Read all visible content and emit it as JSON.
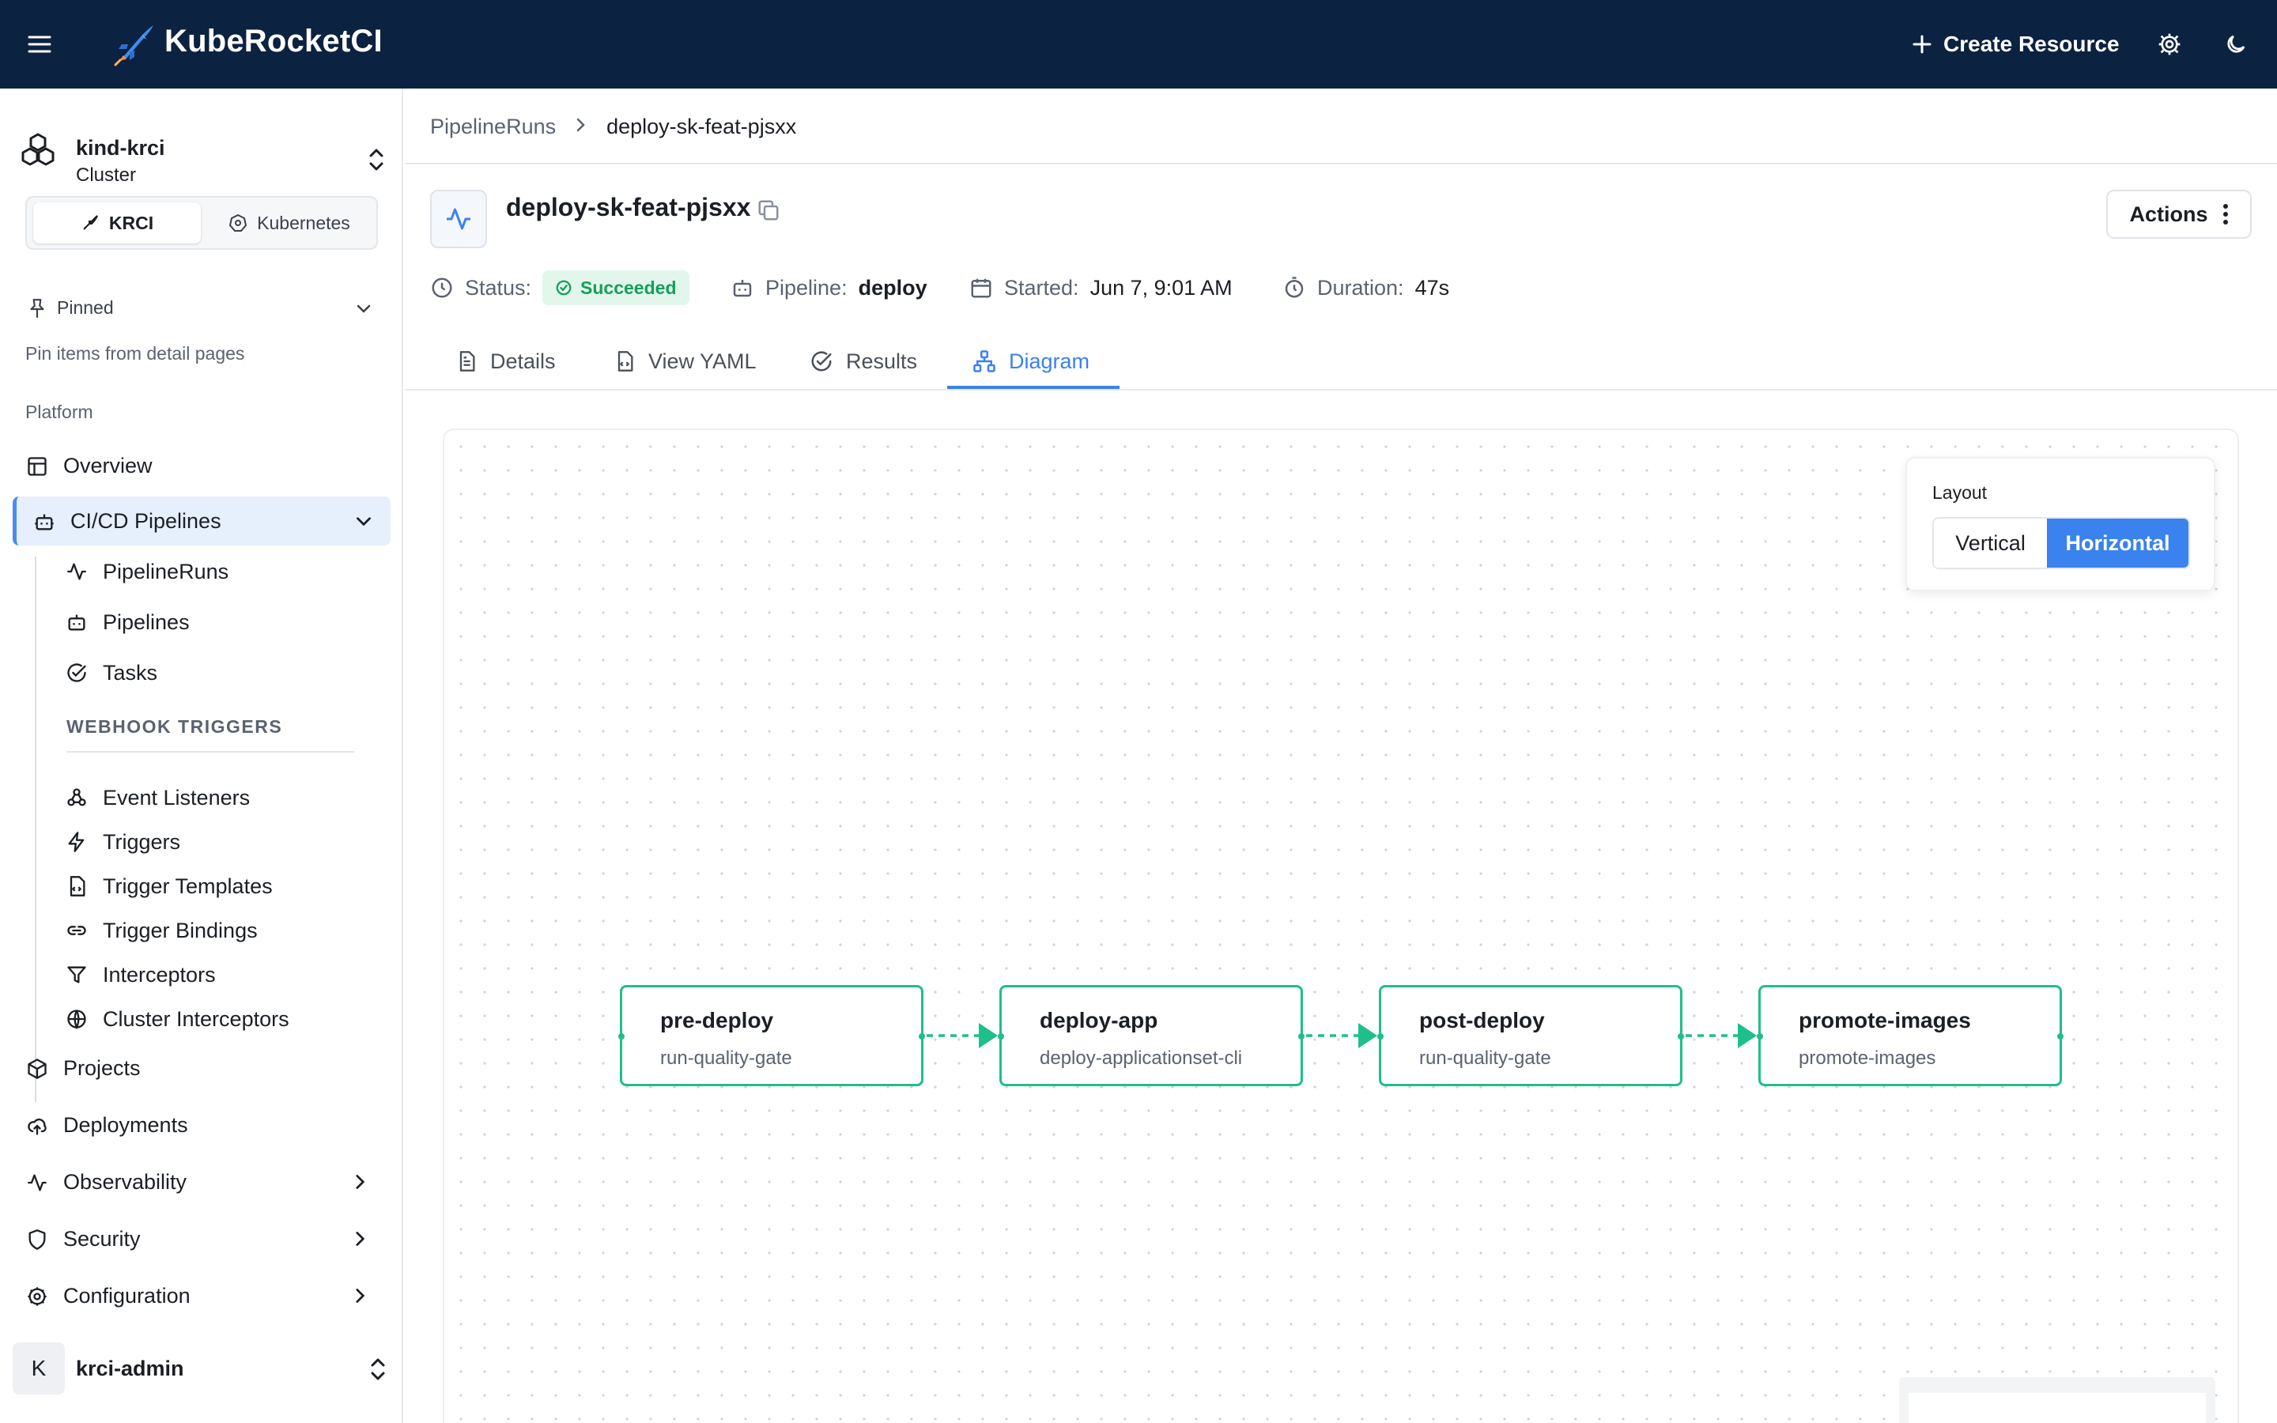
{
  "app": {
    "brand": "KubeRocketCI",
    "create_label": "Create Resource"
  },
  "sidebar": {
    "cluster_name": "kind-krci",
    "cluster_sub": "Cluster",
    "mode_krci": "KRCI",
    "mode_k8s": "Kubernetes",
    "pinned_label": "Pinned",
    "pinned_hint": "Pin items from detail pages",
    "section_platform": "Platform",
    "overview": "Overview",
    "cicd": "CI/CD Pipelines",
    "sub_items": [
      "PipelineRuns",
      "Pipelines",
      "Tasks"
    ],
    "webhook_heading": "WEBHOOK TRIGGERS",
    "webhook_items": [
      "Event Listeners",
      "Triggers",
      "Trigger Templates",
      "Trigger Bindings",
      "Interceptors",
      "Cluster Interceptors"
    ],
    "projects": "Projects",
    "deployments": "Deployments",
    "observability": "Observability",
    "security": "Security",
    "configuration": "Configuration",
    "user_initial": "K",
    "user_name": "krci-admin"
  },
  "breadcrumb": {
    "parent": "PipelineRuns",
    "current": "deploy-sk-feat-pjsxx"
  },
  "header": {
    "title": "deploy-sk-feat-pjsxx",
    "actions_label": "Actions",
    "status_label": "Status:",
    "status_value": "Succeeded",
    "pipeline_label": "Pipeline:",
    "pipeline_value": "deploy",
    "started_label": "Started:",
    "started_value": "Jun 7, 9:01 AM",
    "duration_label": "Duration:",
    "duration_value": "47s"
  },
  "tabs": [
    "Details",
    "View YAML",
    "Results",
    "Diagram"
  ],
  "active_tab": "Diagram",
  "diagram": {
    "layout_label": "Layout",
    "layout_vertical": "Vertical",
    "layout_horizontal": "Horizontal",
    "selected_layout": "Horizontal",
    "nodes": [
      {
        "title": "pre-deploy",
        "subtitle": "run-quality-gate"
      },
      {
        "title": "deploy-app",
        "subtitle": "deploy-applicationset-cli"
      },
      {
        "title": "post-deploy",
        "subtitle": "run-quality-gate"
      },
      {
        "title": "promote-images",
        "subtitle": "promote-images"
      }
    ]
  },
  "colors": {
    "topbar": "#0b2240",
    "accent": "#3a82ee",
    "success": "#13a05a",
    "node_border": "#1ebf8b"
  }
}
